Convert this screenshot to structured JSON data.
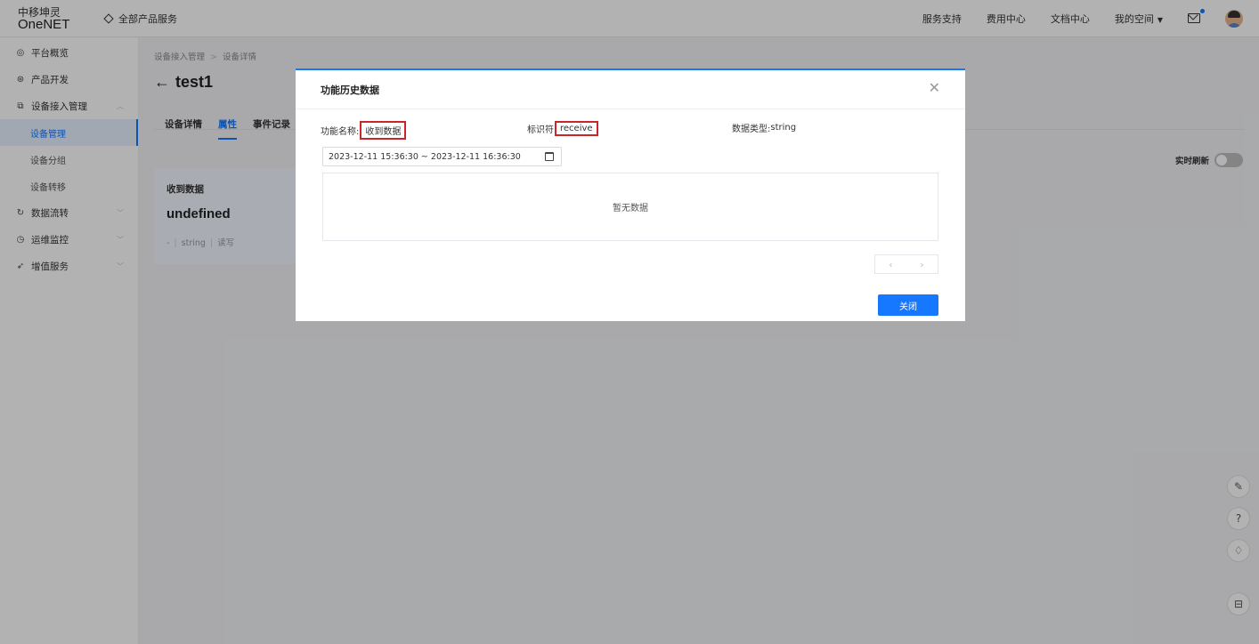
{
  "topbar": {
    "logo_cn": "中移坤灵",
    "logo_en": "OneNET",
    "all_products": "全部产品服务",
    "nav": [
      "服务支持",
      "费用中心",
      "文档中心"
    ],
    "space": "我的空间",
    "icons": {
      "all_products": "diamond-icon",
      "mail": "mail-icon",
      "space": "caret-down-icon"
    }
  },
  "sidebar": {
    "items": [
      {
        "label": "平台概览",
        "icon": "dashboard-icon"
      },
      {
        "label": "产品开发",
        "icon": "cube-icon"
      },
      {
        "label": "设备接入管理",
        "icon": "device-icon"
      }
    ],
    "subitems": [
      "设备管理",
      "设备分组",
      "设备转移"
    ],
    "more_items": [
      {
        "label": "数据流转",
        "icon": "flow-icon"
      },
      {
        "label": "运维监控",
        "icon": "monitor-icon"
      },
      {
        "label": "增值服务",
        "icon": "service-icon"
      }
    ]
  },
  "main": {
    "breadcrumb": [
      "设备接入管理",
      "设备详情"
    ],
    "title": "test1",
    "tabs": [
      "设备详情",
      "属性",
      "事件记录"
    ],
    "realtime_label": "实时刷新",
    "card": {
      "name": "收到数据",
      "value": "undefined",
      "meta1": "-",
      "meta2": "string",
      "meta3": "读写"
    }
  },
  "modal": {
    "title": "功能历史数据",
    "func_name_label": "功能名称:",
    "func_name_value": "收到数据",
    "identifier_label": "标识符",
    "identifier_value": "receive",
    "datatype_label": "数据类型:",
    "datatype_value": "string",
    "date_range": "2023-12-11 15:36:30 ~ 2023-12-11 16:36:30",
    "empty_text": "暂无数据",
    "close_button": "关闭",
    "accent_color": "#1677ff",
    "highlight_color": "#c8262b"
  },
  "fabs": [
    "edit-icon",
    "help-icon",
    "service-icon",
    "collapse-icon"
  ]
}
